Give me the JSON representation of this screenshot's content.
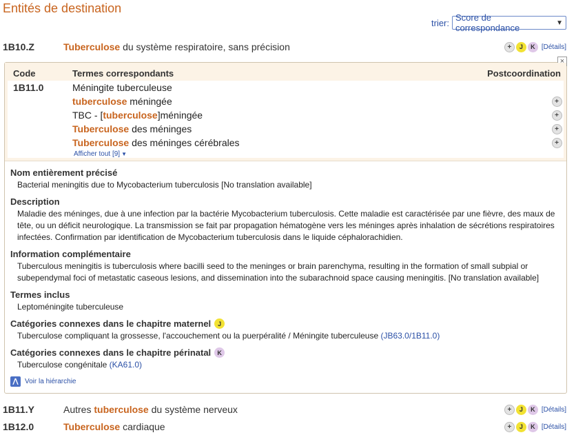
{
  "page_title": "Entités de destination",
  "sort": {
    "label": "trier:",
    "selected": "Score de correspondance"
  },
  "entity_top": {
    "code": "1B10.Z",
    "name_hl": "Tuberculose",
    "name_rest": " du système respiratoire, sans précision",
    "details": "[Détails]"
  },
  "panel": {
    "close": "×",
    "headers": {
      "code": "Code",
      "terms": "Termes correspondants",
      "postcoord": "Postcoordination"
    },
    "code": "1B11.0",
    "terms": [
      {
        "pre": "",
        "hl": "",
        "post": "Méningite tuberculeuse",
        "plus": false
      },
      {
        "pre": "",
        "hl": "tuberculose",
        "post": " méningée",
        "plus": true
      },
      {
        "pre": "TBC - [",
        "hl": "tuberculose",
        "post": "]méningée",
        "plus": true
      },
      {
        "pre": "",
        "hl": "Tuberculose",
        "post": " des méninges",
        "plus": true
      },
      {
        "pre": "",
        "hl": "Tuberculose",
        "post": " des méninges cérébrales",
        "plus": true
      }
    ],
    "show_all": "Afficher tout [9]",
    "sections": {
      "full_name_title": "Nom entièrement précisé",
      "full_name": "Bacterial meningitis due to Mycobacterium tuberculosis [No translation available]",
      "description_title": "Description",
      "description": "Maladie des méninges, due à une infection par la bactérie Mycobacterium tuberculosis. Cette maladie est caractérisée par une fièvre, des maux de tête, ou un déficit neurologique. La transmission se fait par propagation hématogène vers les méninges après inhalation de sécrétions respiratoires infectées. Confirmation par identification de Mycobacterium tuberculosis dans le liquide céphalorachidien.",
      "additional_title": "Information complémentaire",
      "additional": "Tuberculous meningitis is tuberculosis where bacilli seed to the meninges or brain parenchyma, resulting in the formation of small subpial or subependymal foci of metastatic caseous lesions, and dissemination into the subarachnoid space causing meningitis. [No translation available]",
      "inclusions_title": "Termes inclus",
      "inclusions": "Leptoméningite tuberculeuse",
      "maternal_title": "Catégories connexes dans le chapitre maternel",
      "maternal_badge": "J",
      "maternal_text": "Tuberculose compliquant la grossesse, l'accouchement ou la puerpéralité / Méningite tuberculeuse",
      "maternal_code": "(JB63.0/1B11.0)",
      "perinatal_title": "Catégories connexes dans le chapitre périnatal",
      "perinatal_badge": "K",
      "perinatal_text": "Tuberculose congénitale",
      "perinatal_code": "(KA61.0)"
    },
    "hierarchy_link": "Voir la hiérarchie"
  },
  "entities_bottom": [
    {
      "code": "1B11.Y",
      "pre": "Autres ",
      "hl": "tuberculose",
      "post": " du système nerveux",
      "details": "[Détails]"
    },
    {
      "code": "1B12.0",
      "pre": "",
      "hl": "Tuberculose",
      "post": " cardiaque",
      "details": "[Détails]"
    }
  ],
  "badges": {
    "plus": "+",
    "j": "J",
    "k": "K"
  },
  "colors": {
    "accent": "#c8641e",
    "link": "#2b50a6",
    "panel_bg": "#fcf3e6",
    "badge_j": "#f2e233",
    "badge_k": "#dfc8e8"
  }
}
